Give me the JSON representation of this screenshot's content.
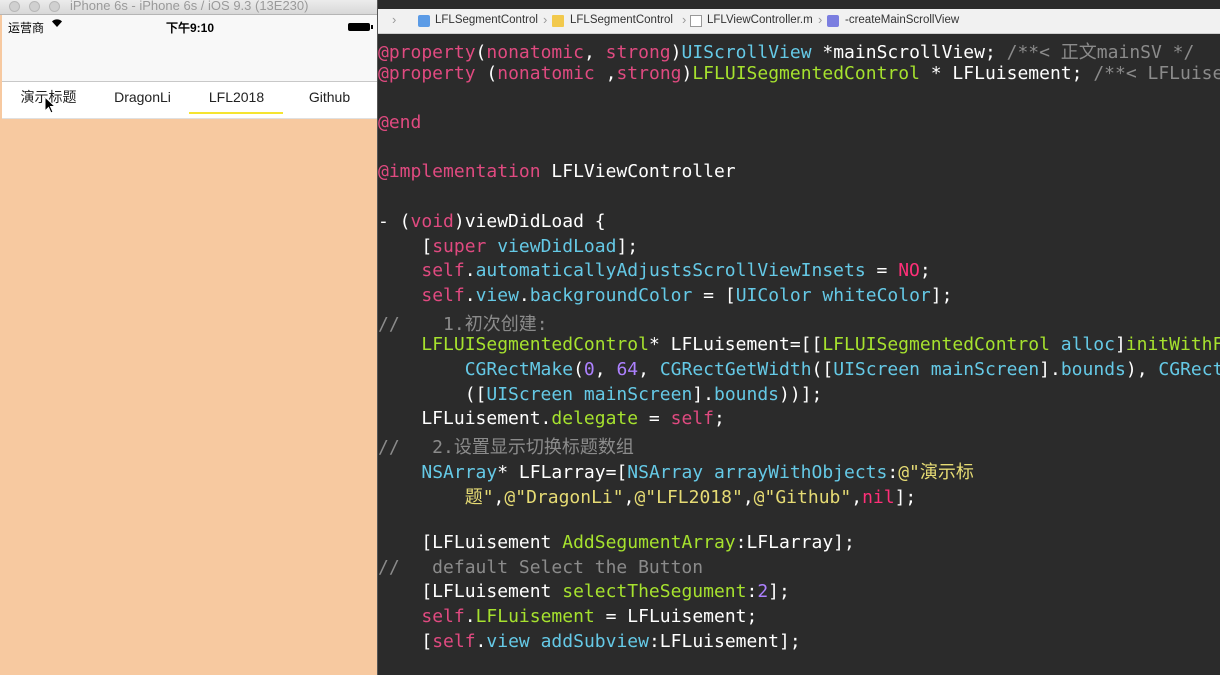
{
  "simulator": {
    "title": "iPhone 6s - iPhone 6s / iOS 9.3 (13E230)",
    "statusbar": {
      "carrier": "运营商",
      "time": "下午9:10"
    },
    "segments": [
      {
        "label": "演示标题"
      },
      {
        "label": "DragonLi"
      },
      {
        "label": "LFL2018"
      },
      {
        "label": "Github"
      }
    ],
    "selected_segment": 2,
    "background_color": "#f7c9a0",
    "indicator_color": "#f5e431"
  },
  "jumpbar": {
    "items": [
      "LFLSegmentControl",
      "LFLSegmentControl",
      "LFLViewController.m",
      "-createMainScrollView"
    ]
  },
  "code": {
    "lines": [
      "@property(nonatomic, strong)UIScrollView *mainScrollView; /**< 正文mainSV */",
      "@property (nonatomic ,strong)LFLUISegmentedControl * LFLuisement; /**< LFLuisement",
      "",
      "@end",
      "",
      "@implementation LFLViewController",
      "",
      "- (void)viewDidLoad {",
      "    [super viewDidLoad];",
      "    self.automaticallyAdjustsScrollViewInsets = NO;",
      "    self.view.backgroundColor = [UIColor whiteColor];",
      "//    1.初次创建:",
      "    LFLUISegmentedControl* LFLuisement=[[LFLUISegmentedControl alloc]initWithFrame:",
      "        CGRectMake(0, 64, CGRectGetWidth([UIScreen mainScreen].bounds), CGRectGetHeight",
      "        ([UIScreen mainScreen].bounds))];",
      "    LFLuisement.delegate = self;",
      "//   2.设置显示切换标题数组",
      "    NSArray* LFLarray=[NSArray arrayWithObjects:@\"演示标",
      "        题\",@\"DragonLi\",@\"LFL2018\",@\"Github\",nil];",
      "",
      "    [LFLuisement AddSegumentArray:LFLarray];",
      "//   default Select the Button",
      "    [LFLuisement selectTheSegument:2];",
      "    self.LFLuisement = LFLuisement;",
      "    [self.view addSubview:LFLuisement];"
    ]
  }
}
